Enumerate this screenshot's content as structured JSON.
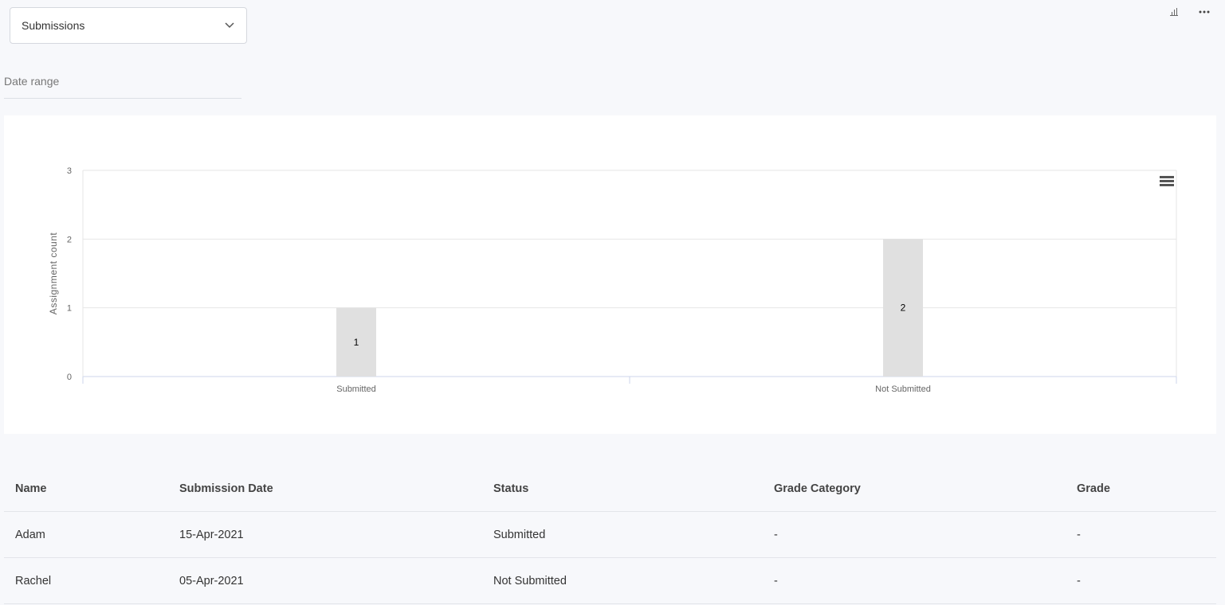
{
  "filter": {
    "selected": "Submissions"
  },
  "toolbar": {
    "icons": [
      "bar-chart-icon",
      "more-icon"
    ]
  },
  "date_range": {
    "label": "Date range"
  },
  "chart_data": {
    "type": "bar",
    "categories": [
      "Submitted",
      "Not Submitted"
    ],
    "series": [
      {
        "values": [
          1,
          2
        ]
      }
    ],
    "data_labels": [
      "1",
      "2"
    ],
    "ylabel": "Assignment count",
    "xlabel": "",
    "ylim": [
      0,
      3
    ],
    "yticks": [
      "0",
      "1",
      "2",
      "3"
    ],
    "grid": true,
    "bar_color": "#e0e0e0",
    "menu_icon": "hamburger-menu-icon"
  },
  "table": {
    "headers": [
      "Name",
      "Submission Date",
      "Status",
      "Grade Category",
      "Grade"
    ],
    "rows": [
      [
        "Adam",
        "15-Apr-2021",
        "Submitted",
        "-",
        "-"
      ],
      [
        "Rachel",
        "05-Apr-2021",
        "Not Submitted",
        "-",
        "-"
      ]
    ]
  }
}
